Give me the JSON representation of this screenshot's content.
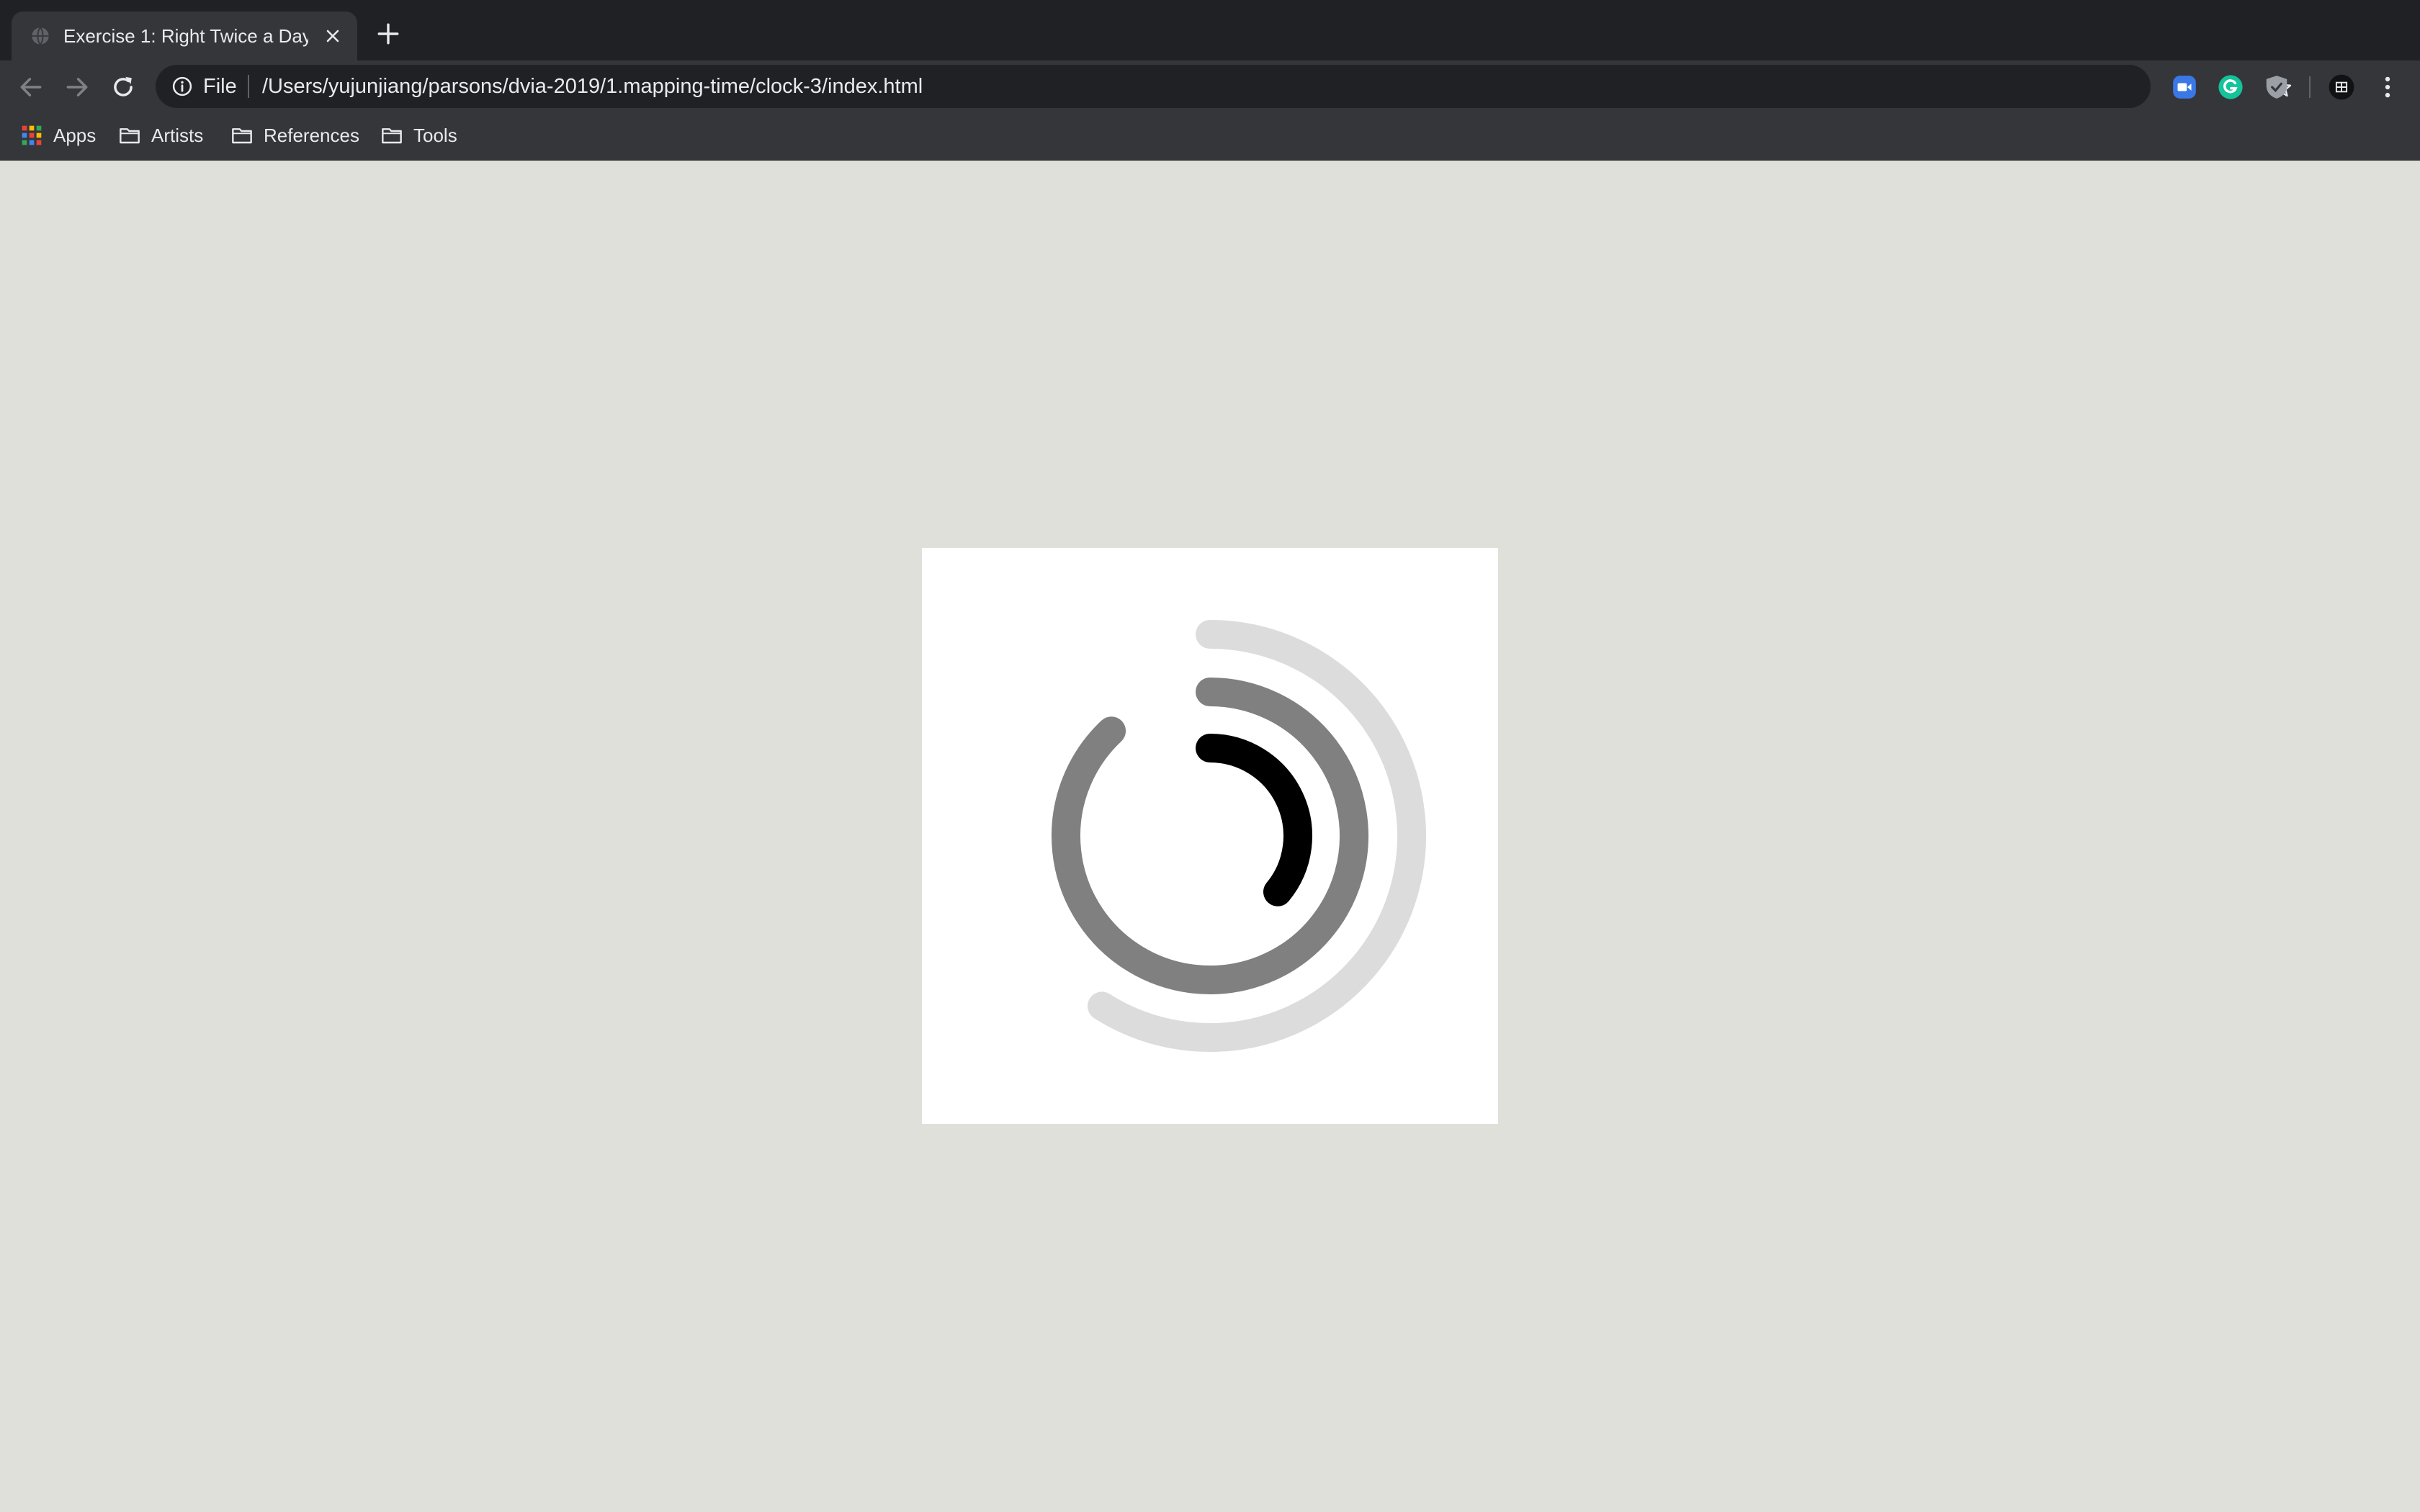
{
  "tab": {
    "title": "Exercise 1: Right Twice a Day"
  },
  "omnibox": {
    "scheme": "File",
    "url": "/Users/yujunjiang/parsons/dvia-2019/1.mapping-time/clock-3/index.html"
  },
  "bookmarks": [
    {
      "label": "Apps",
      "icon": "apps-grid-icon"
    },
    {
      "label": "Artists",
      "icon": "folder-icon"
    },
    {
      "label": "References",
      "icon": "folder-icon"
    },
    {
      "label": "Tools",
      "icon": "folder-icon"
    }
  ],
  "clock": {
    "background": "#ffffff",
    "arcs": [
      {
        "name": "outer-arc",
        "color": "#dcdcdc",
        "fraction": 0.59
      },
      {
        "name": "middle-arc",
        "color": "#808080",
        "fraction": 0.88
      },
      {
        "name": "inner-arc",
        "color": "#000000",
        "fraction": 0.36
      }
    ]
  },
  "colors": {
    "page_background": "#e0e0da",
    "tabstrip": "#202124",
    "toolbar": "#35363a"
  }
}
